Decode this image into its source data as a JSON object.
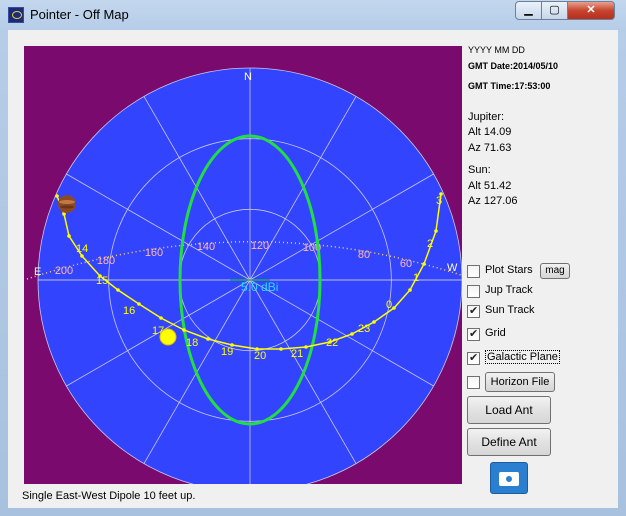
{
  "window": {
    "title": "Pointer - Off Map",
    "close_glyph": "✕",
    "max_glyph": "▢",
    "min_glyph": "▁"
  },
  "plot": {
    "cardinals": {
      "n": "N",
      "s": "S",
      "e": "E",
      "w": "W"
    },
    "gain_label": "5.0 dBi",
    "galactic_ticks": [
      "200",
      "180",
      "160",
      "140",
      "120",
      "100",
      "80",
      "60"
    ],
    "sun_hours": [
      "3",
      "2",
      "1",
      "0",
      "23",
      "22",
      "21",
      "20",
      "19",
      "18",
      "17",
      "16",
      "15",
      "14"
    ],
    "colors": {
      "background": "#7a0a6e",
      "sky": "#3344ff",
      "grid": "#c8c8e8",
      "pattern": "#22dd44",
      "track": "#ffff00",
      "galactic": "#ffd060",
      "tick_text": "#ffb8b8",
      "gain_text": "#22ddff"
    }
  },
  "info": {
    "date_header": "YYYY  MM  DD",
    "gmt_date": "GMT Date:2014/05/10",
    "gmt_time": "GMT Time:17:53:00",
    "jupiter_label": "Jupiter:",
    "jupiter_alt": "Alt 14.09",
    "jupiter_az": "Az 71.63",
    "sun_label": "Sun:",
    "sun_alt": "Alt 51.42",
    "sun_az": "Az 127.06"
  },
  "controls": {
    "plot_stars": "Plot Stars",
    "mag": "mag",
    "jup_track": "Jup Track",
    "sun_track": "Sun Track",
    "grid": "Grid",
    "galactic_plane": "Galactic Plane",
    "horizon_file": "Horizon File",
    "load_ant": "Load Ant",
    "define_ant": "Define Ant"
  },
  "status": "Single East-West Dipole 10 feet up."
}
